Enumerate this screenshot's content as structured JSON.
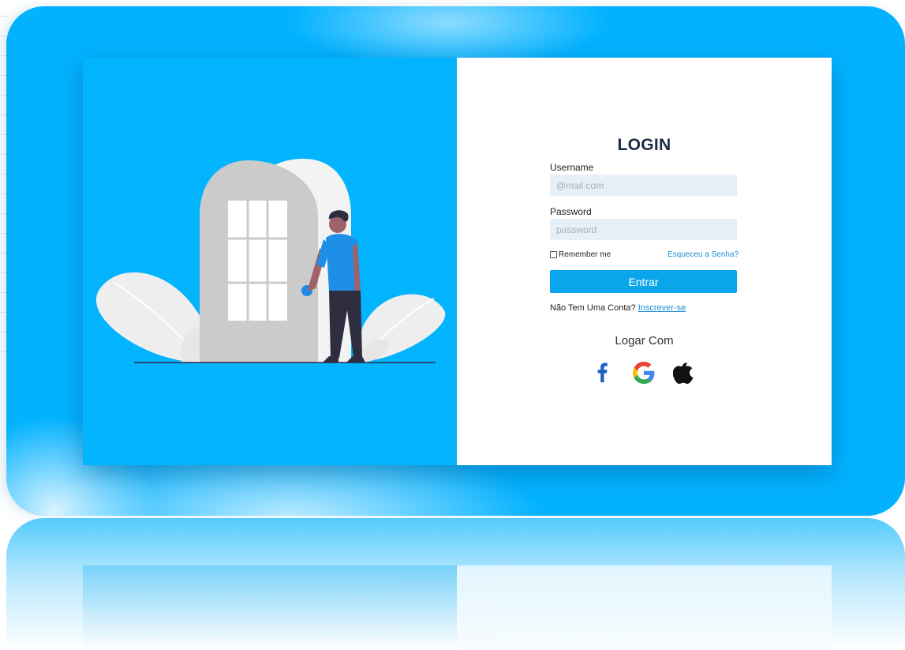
{
  "login": {
    "title": "LOGIN",
    "username_label": "Username",
    "username_placeholder": "@mail.com",
    "password_label": "Password",
    "password_placeholder": "password",
    "remember_label": "Remember me",
    "forgot_link": "Esqueceu a Senha?",
    "submit_label": "Entrar",
    "signup_prompt": "Não Tem Uma Conta?",
    "signup_link": "Inscrever-se",
    "social_title": "Logar Com"
  },
  "social": {
    "icons": [
      "facebook-icon",
      "google-icon",
      "apple-icon"
    ]
  },
  "colors": {
    "background_blue": "#03b2ff",
    "button_blue": "#09a6ec",
    "link_blue": "#1a8ed8",
    "input_bg": "#e6f0f8",
    "title_color": "#1a2a44"
  }
}
